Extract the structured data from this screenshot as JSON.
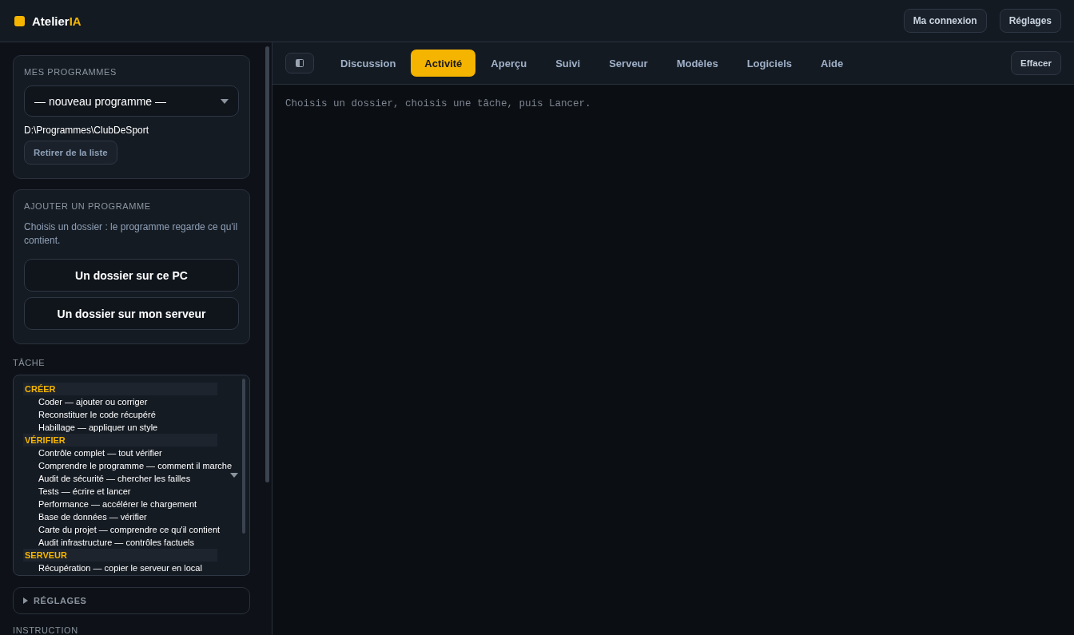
{
  "app": {
    "logo_prefix": "Atelier",
    "logo_accent": "IA"
  },
  "header_buttons": [
    "Ma connexion",
    "Réglages"
  ],
  "sidebar": {
    "programs": {
      "title": "MES PROGRAMMES",
      "select_value": "— nouveau programme —",
      "path": "D:\\Programmes\\ClubDeSport",
      "remove_button": "Retirer de la liste"
    },
    "add": {
      "title": "AJOUTER UN PROGRAMME",
      "description": "Choisis un dossier : le programme regarde ce qu'il contient.",
      "buttons": [
        "Un dossier sur ce PC",
        "Un dossier sur mon serveur"
      ]
    },
    "task": {
      "label": "TÂCHE",
      "groups": [
        {
          "name": "CRÉER",
          "items": [
            "Coder — ajouter ou corriger",
            "Reconstituer le code récupéré",
            "Habillage — appliquer un style"
          ]
        },
        {
          "name": "VÉRIFIER",
          "items": [
            "Contrôle complet — tout vérifier",
            "Comprendre le programme — comment il marche",
            "Audit de sécurité — chercher les failles",
            "Tests — écrire et lancer",
            "Performance — accélérer le chargement",
            "Base de données — vérifier",
            "Carte du projet — comprendre ce qu'il contient",
            "Audit infrastructure — contrôles factuels"
          ]
        },
        {
          "name": "SERVEUR",
          "items": [
            "Récupération — copier le serveur en local"
          ]
        }
      ]
    },
    "settings": {
      "label": "RÉGLAGES",
      "expanded": false
    },
    "instruction_label": "INSTRUCTION"
  },
  "tabs": [
    {
      "label": "Discussion",
      "selected": false
    },
    {
      "label": "Activité",
      "selected": true
    },
    {
      "label": "Aperçu",
      "selected": false
    },
    {
      "label": "Suivi",
      "selected": false
    },
    {
      "label": "Serveur",
      "selected": false
    },
    {
      "label": "Modèles",
      "selected": false
    },
    {
      "label": "Logiciels",
      "selected": false
    },
    {
      "label": "Aide",
      "selected": false
    }
  ],
  "clear_button": "Effacer",
  "message": "Choisis un dossier, choisis une tâche, puis Lancer."
}
